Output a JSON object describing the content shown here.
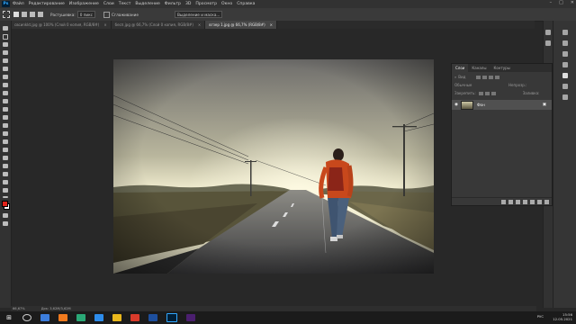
{
  "app": {
    "logo": "Ps"
  },
  "menu": [
    "Файл",
    "Редактирование",
    "Изображение",
    "Слои",
    "Текст",
    "Выделение",
    "Фильтр",
    "3D",
    "Просмотр",
    "Окно",
    "Справка"
  ],
  "window_controls": [
    "–",
    "□",
    "✕"
  ],
  "options": {
    "feather_label": "Растушевка:",
    "feather_value": "0 пикс",
    "antialias_label": "Сглаживание",
    "select_mask_label": "Выделение и маска..."
  },
  "tabs": [
    {
      "label": "cвсиnkkt.jpg @ 100% (Слой 0 копия, RGB/8#)",
      "active": false
    },
    {
      "label": "бесп.jpg @ 66,7% (Слой 0 копия, RGB/8#)",
      "active": false
    },
    {
      "label": "вгзер 1.jpg @ 66,7% (RGB/8#)",
      "active": true
    }
  ],
  "status": {
    "zoom": "66,67%",
    "doc": "Док: 3,62M/3,62M"
  },
  "layers_panel": {
    "tabs": [
      "Слои",
      "Каналы",
      "Контуры"
    ],
    "search_placeholder": "Вид",
    "blend_mode": "Обычные",
    "opacity_label": "Непрозр.:",
    "lock_label": "Закрепить:",
    "fill_label": "Заливка:",
    "layer_name": "Фон"
  },
  "tray": {
    "lang": "РУС",
    "time": "15:56",
    "date": "12.05.2021"
  }
}
